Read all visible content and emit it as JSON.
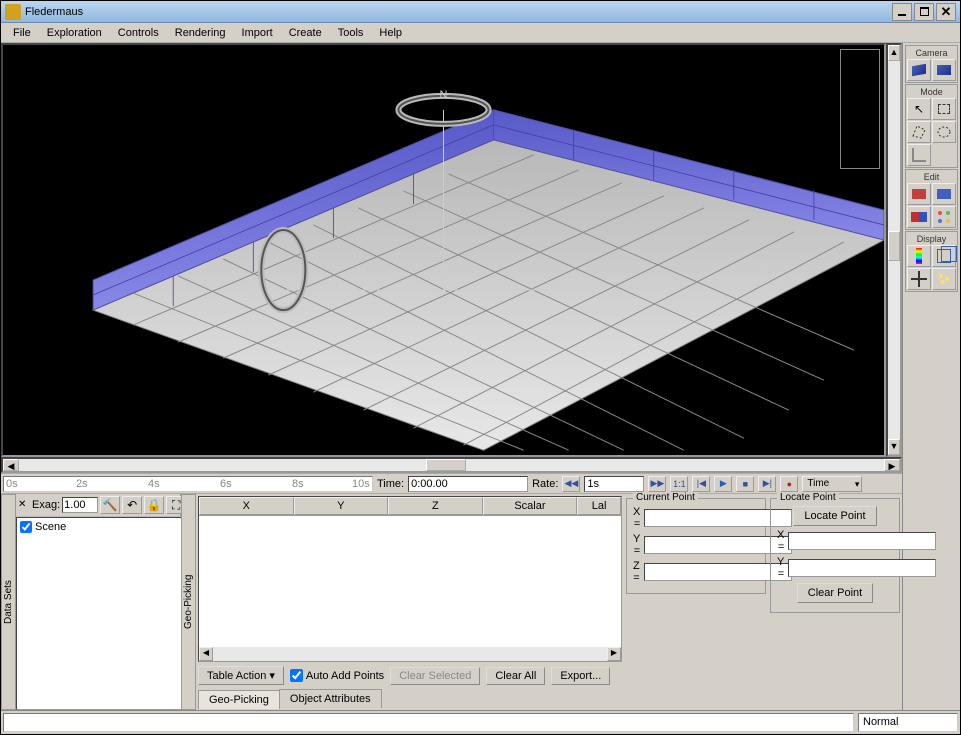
{
  "window": {
    "title": "Fledermaus"
  },
  "menu": [
    "File",
    "Exploration",
    "Controls",
    "Rendering",
    "Import",
    "Create",
    "Tools",
    "Help"
  ],
  "sidebar": {
    "camera": {
      "legend": "Camera"
    },
    "mode": {
      "legend": "Mode"
    },
    "edit": {
      "legend": "Edit"
    },
    "display": {
      "legend": "Display"
    }
  },
  "time": {
    "ticks": [
      "0s",
      "2s",
      "4s",
      "6s",
      "8s",
      "10s"
    ],
    "time_label": "Time:",
    "time_value": "0:00.00",
    "rate_label": "Rate:",
    "rate_value": "1s",
    "ratio": "1:1",
    "dropdown": "Time"
  },
  "datasets": {
    "vlabel": "Data Sets",
    "exag_label": "Exag:",
    "exag_value": "1.00",
    "scene": "Scene"
  },
  "geo": {
    "vlabel": "Geo-Picking",
    "columns": [
      "X",
      "Y",
      "Z",
      "Scalar",
      "Lal"
    ],
    "table_action": "Table Action",
    "auto_add": "Auto Add Points",
    "clear_selected": "Clear Selected",
    "clear_all": "Clear All",
    "export": "Export...",
    "tabs": [
      "Geo-Picking",
      "Object Attributes"
    ]
  },
  "current_point": {
    "legend": "Current Point",
    "x": "X =",
    "y": "Y =",
    "z": "Z ="
  },
  "locate_point": {
    "legend": "Locate Point",
    "locate": "Locate Point",
    "x": "X =",
    "y": "Y =",
    "clear": "Clear Point"
  },
  "status": {
    "mode": "Normal"
  }
}
